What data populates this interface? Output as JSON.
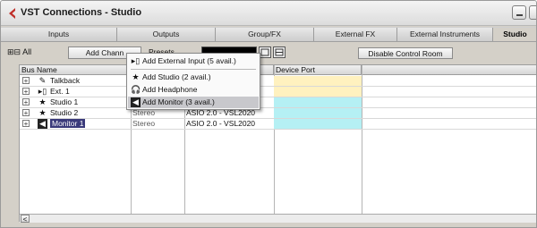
{
  "window": {
    "title": "VST Connections - Studio",
    "icon": "cubase-logo-icon"
  },
  "tabs": [
    {
      "label": "Inputs",
      "active": false
    },
    {
      "label": "Outputs",
      "active": false
    },
    {
      "label": "Group/FX",
      "active": false
    },
    {
      "label": "External FX",
      "active": false
    },
    {
      "label": "External Instruments",
      "active": false
    },
    {
      "label": "Studio",
      "active": true
    }
  ],
  "toolbar": {
    "expand_all_label": "All",
    "add_channel_label": "Add Chann",
    "presets_label": "Presets",
    "disable_control_room_label": "Disable Control Room"
  },
  "table": {
    "columns": [
      "Bus Name",
      "",
      "",
      "Device Port"
    ],
    "rows": [
      {
        "icon": "talkback-icon",
        "name": "Talkback",
        "speakers": "",
        "device": "",
        "port_color": "#fff1bf"
      },
      {
        "icon": "external-input-icon",
        "name": "Ext. 1",
        "speakers": "",
        "device": "",
        "port_color": "#fff1bf"
      },
      {
        "icon": "star-icon",
        "name": "Studio 1",
        "speakers": "",
        "device": "",
        "port_color": "#b5f0f4"
      },
      {
        "icon": "star-icon",
        "name": "Studio 2",
        "speakers": "Stereo",
        "device": "ASIO 2.0 - VSL2020",
        "port_color": "#b5f0f4"
      },
      {
        "icon": "monitor-icon",
        "name": "Monitor 1",
        "speakers": "Stereo",
        "device": "ASIO 2.0 - VSL2020",
        "port_color": "#b5f0f4",
        "selected": true
      }
    ]
  },
  "context_menu": {
    "items": [
      {
        "icon": "external-input-icon",
        "label": "Add External Input (5 avail.)"
      },
      {
        "icon": "star-icon",
        "label": "Add Studio (2 avail.)"
      },
      {
        "icon": "headphone-icon",
        "label": "Add Headphone"
      },
      {
        "icon": "monitor-icon",
        "label": "Add Monitor (3 avail.)",
        "highlighted": true
      }
    ]
  },
  "colors": {
    "accent_red": "#c0302a",
    "selection": "#3a3a7a",
    "port_yellow": "#fff1bf",
    "port_cyan": "#b5f0f4"
  }
}
